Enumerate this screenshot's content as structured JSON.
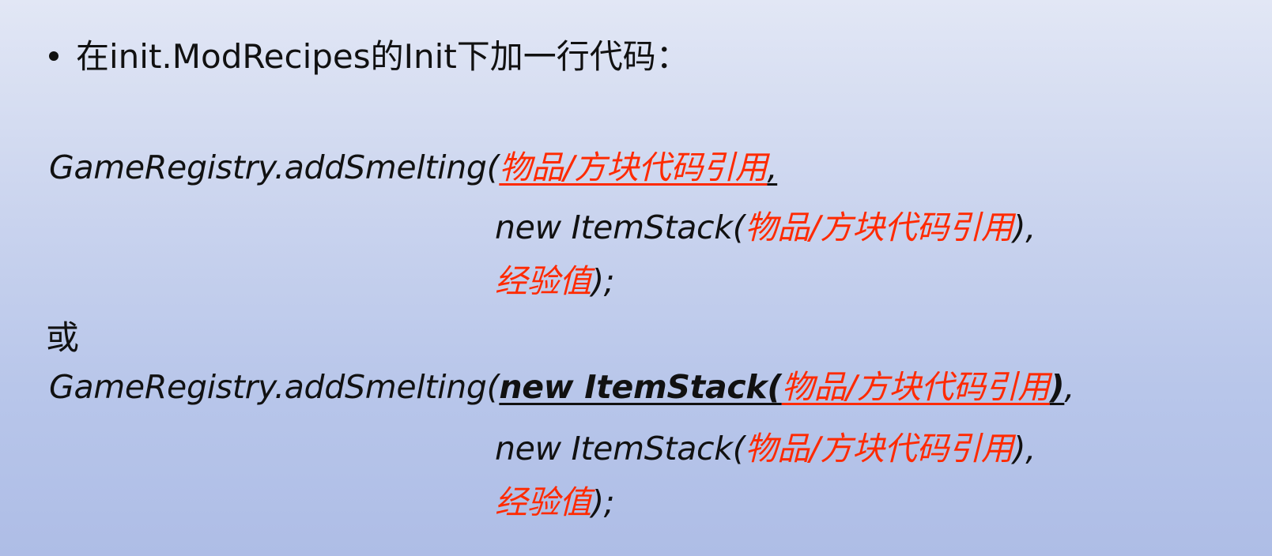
{
  "heading": {
    "text": "在init.ModRecipes的Init下加一行代码："
  },
  "block1": {
    "line1_prefix": "GameRegistry.addSmelting(",
    "line1_arg": "物品/方块代码引用",
    "line1_suffix": ",",
    "line2_prefix": "new ItemStack(",
    "line2_arg": "物品/方块代码引用",
    "line2_suffix": "),",
    "line3_arg": "经验值",
    "line3_suffix": ");"
  },
  "separator": {
    "text": "或"
  },
  "block2": {
    "line1_prefix": "GameRegistry.addSmelting(",
    "line1_bold": "new ItemStack(",
    "line1_arg": "物品/方块代码引用",
    "line1_close": ")",
    "line1_suffix": ",",
    "line2_prefix": "new ItemStack(",
    "line2_arg": "物品/方块代码引用",
    "line2_suffix": "),",
    "line3_arg": "经验值",
    "line3_suffix": ");"
  },
  "colors": {
    "placeholder": "#ff2a00",
    "text": "#111111",
    "background_top": "#e2e7f5",
    "background_bottom": "#aebde6"
  }
}
